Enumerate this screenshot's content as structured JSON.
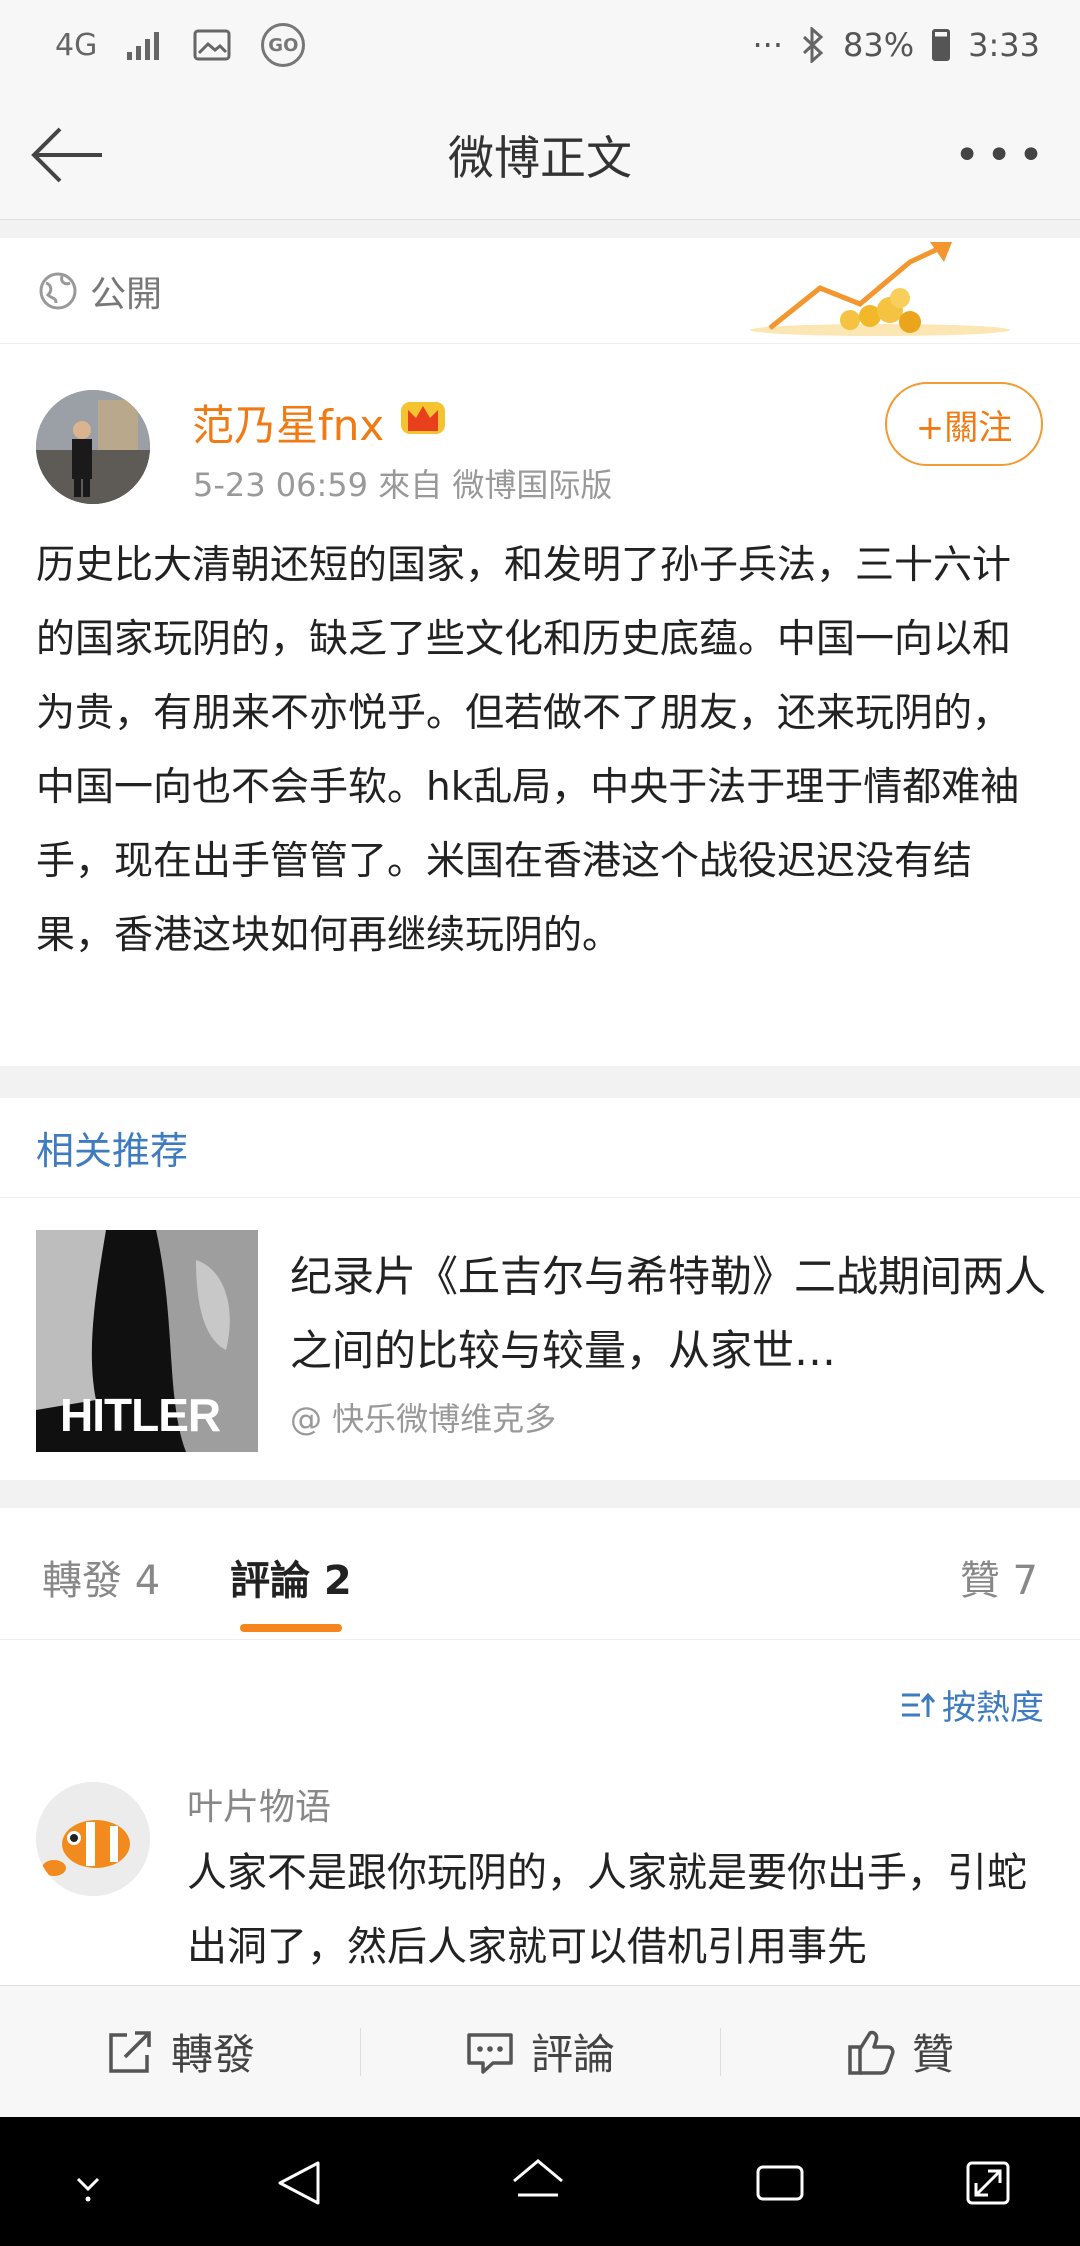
{
  "status_bar": {
    "network": "4G",
    "more": "···",
    "battery": "83%",
    "time": "3:33"
  },
  "nav": {
    "title": "微博正文"
  },
  "privacy": {
    "label": "公開"
  },
  "post": {
    "user_name": "范乃星fnx",
    "follow_label": "+關注",
    "meta": "5-23 06:59   來自 微博国际版",
    "text": "历史比大清朝还短的国家，和发明了孙子兵法，三十六计的国家玩阴的，缺乏了些文化和历史底蕴。中国一向以和为贵，有朋来不亦悦乎。但若做不了朋友，还来玩阴的，中国一向也不会手软。hk乱局，中央于法于理于情都难袖手，现在出手管管了。米国在香港这个战役迟迟没有结果，香港这块如何再继续玩阴的。"
  },
  "related": {
    "title": "相关推荐",
    "card": {
      "thumb_label": "HITLER",
      "title": "纪录片《丘吉尔与希特勒》二战期间两人之间的比较与较量，从家世…",
      "source": "@ 快乐微博维克多"
    }
  },
  "tabs": {
    "repost": "轉發 4",
    "comment": "評論 2",
    "like": "贊 7"
  },
  "comments": {
    "sort_label": "按熱度",
    "items": [
      {
        "name": "叶片物语",
        "text": "人家不是跟你玩阴的，人家就是要你出手，引蛇出洞了，然后人家就可以借机引用事先"
      }
    ]
  },
  "toolbar": {
    "repost": "轉發",
    "comment": "評論",
    "like": "贊"
  },
  "colors": {
    "accent_orange": "#f07a13",
    "link_blue": "#3f7cbf",
    "tab_underline": "#f7851d"
  }
}
